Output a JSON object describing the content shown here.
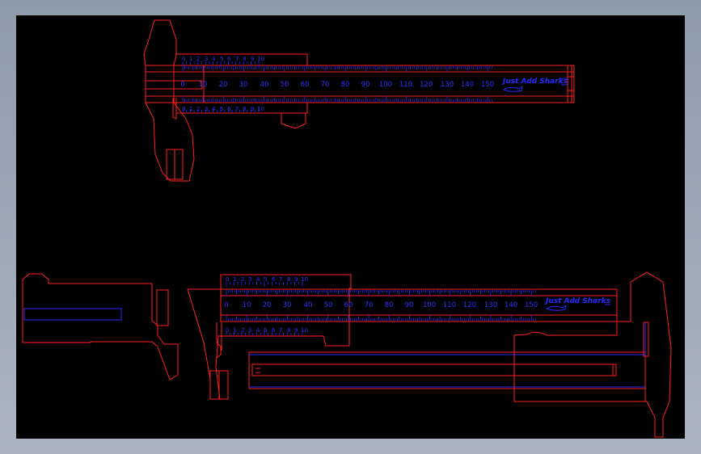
{
  "colors": {
    "window_background": "#9aa6b6",
    "canvas": "#000000",
    "outline": "#ff2020",
    "scale": "#2a2aff"
  },
  "main_scale": {
    "labels": [
      "0",
      "10",
      "20",
      "30",
      "40",
      "50",
      "60",
      "70",
      "80",
      "90",
      "100",
      "110",
      "120",
      "130",
      "140",
      "150"
    ]
  },
  "vernier_scale": {
    "labels": [
      "0",
      "1",
      "2",
      "3",
      "4",
      "5",
      "6",
      "7",
      "8",
      "9",
      "10"
    ]
  },
  "brand": {
    "text": "Just Add Sharks"
  }
}
